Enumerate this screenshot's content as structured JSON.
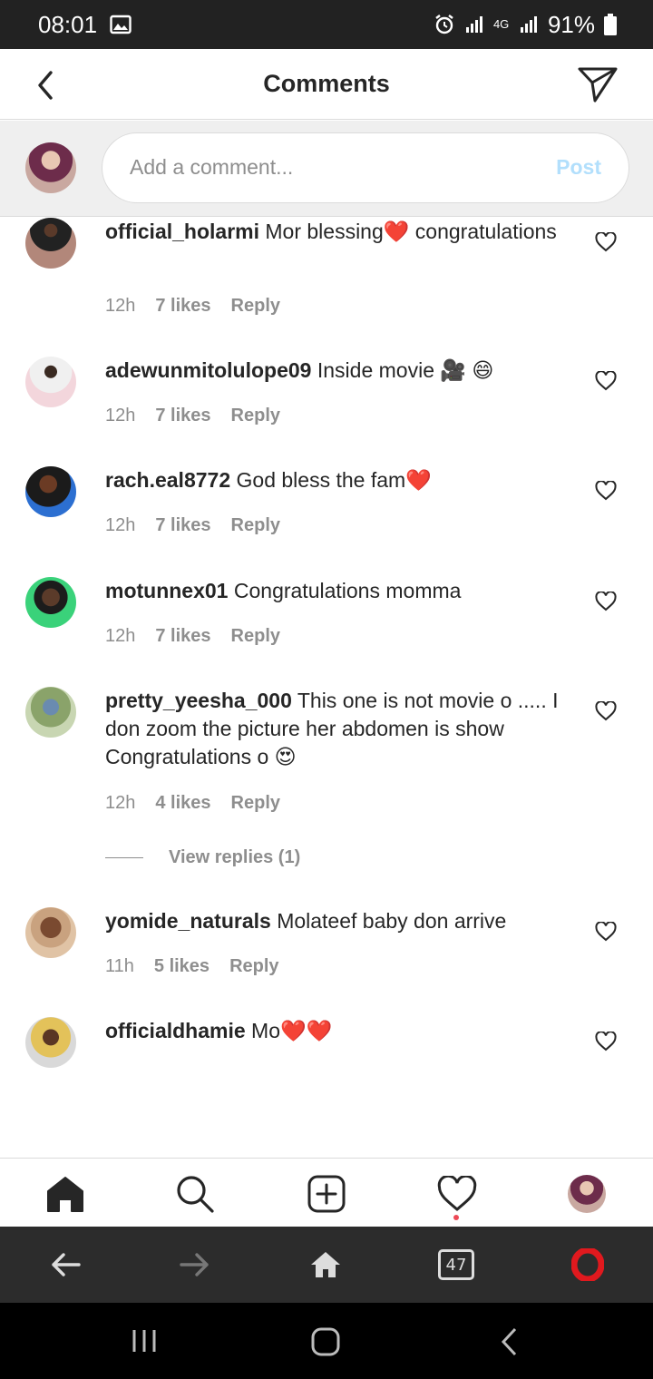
{
  "status_bar": {
    "time": "08:01",
    "network": "4G",
    "battery": "91%"
  },
  "header": {
    "title": "Comments"
  },
  "composer": {
    "placeholder": "Add a comment...",
    "post_label": "Post"
  },
  "comments": [
    {
      "user": "official_holarmi",
      "text": "Mor blessing❤️ congratulations",
      "time": "12h",
      "likes": "7 likes",
      "reply": "Reply"
    },
    {
      "user": "adewunmitolulope09",
      "text": "Inside movie 🎥 😄",
      "time": "12h",
      "likes": "7 likes",
      "reply": "Reply"
    },
    {
      "user": "rach.eal8772",
      "text": "God bless the fam❤️",
      "time": "12h",
      "likes": "7 likes",
      "reply": "Reply"
    },
    {
      "user": "motunnex01",
      "text": "Congratulations momma",
      "time": "12h",
      "likes": "7 likes",
      "reply": "Reply"
    },
    {
      "user": "pretty_yeesha_000",
      "text": "This one is not movie o ..... I don zoom the picture her abdomen is show Congratulations o 😍",
      "time": "12h",
      "likes": "4 likes",
      "reply": "Reply",
      "view_replies": "View replies (1)"
    },
    {
      "user": "yomide_naturals",
      "text": "Molateef baby don arrive",
      "time": "11h",
      "likes": "5 likes",
      "reply": "Reply"
    },
    {
      "user": "officialdhamie",
      "text": "Mo❤️❤️"
    }
  ],
  "bottom_nav": {
    "items": [
      "home-icon",
      "search-icon",
      "new-post-icon",
      "activity-heart-icon",
      "profile-avatar"
    ]
  },
  "browser_bar": {
    "tabs_count": "47"
  },
  "colors": {
    "post_disabled": "#b2dffc",
    "notification_dot": "#ed4956",
    "opera_red": "#e0191e"
  }
}
